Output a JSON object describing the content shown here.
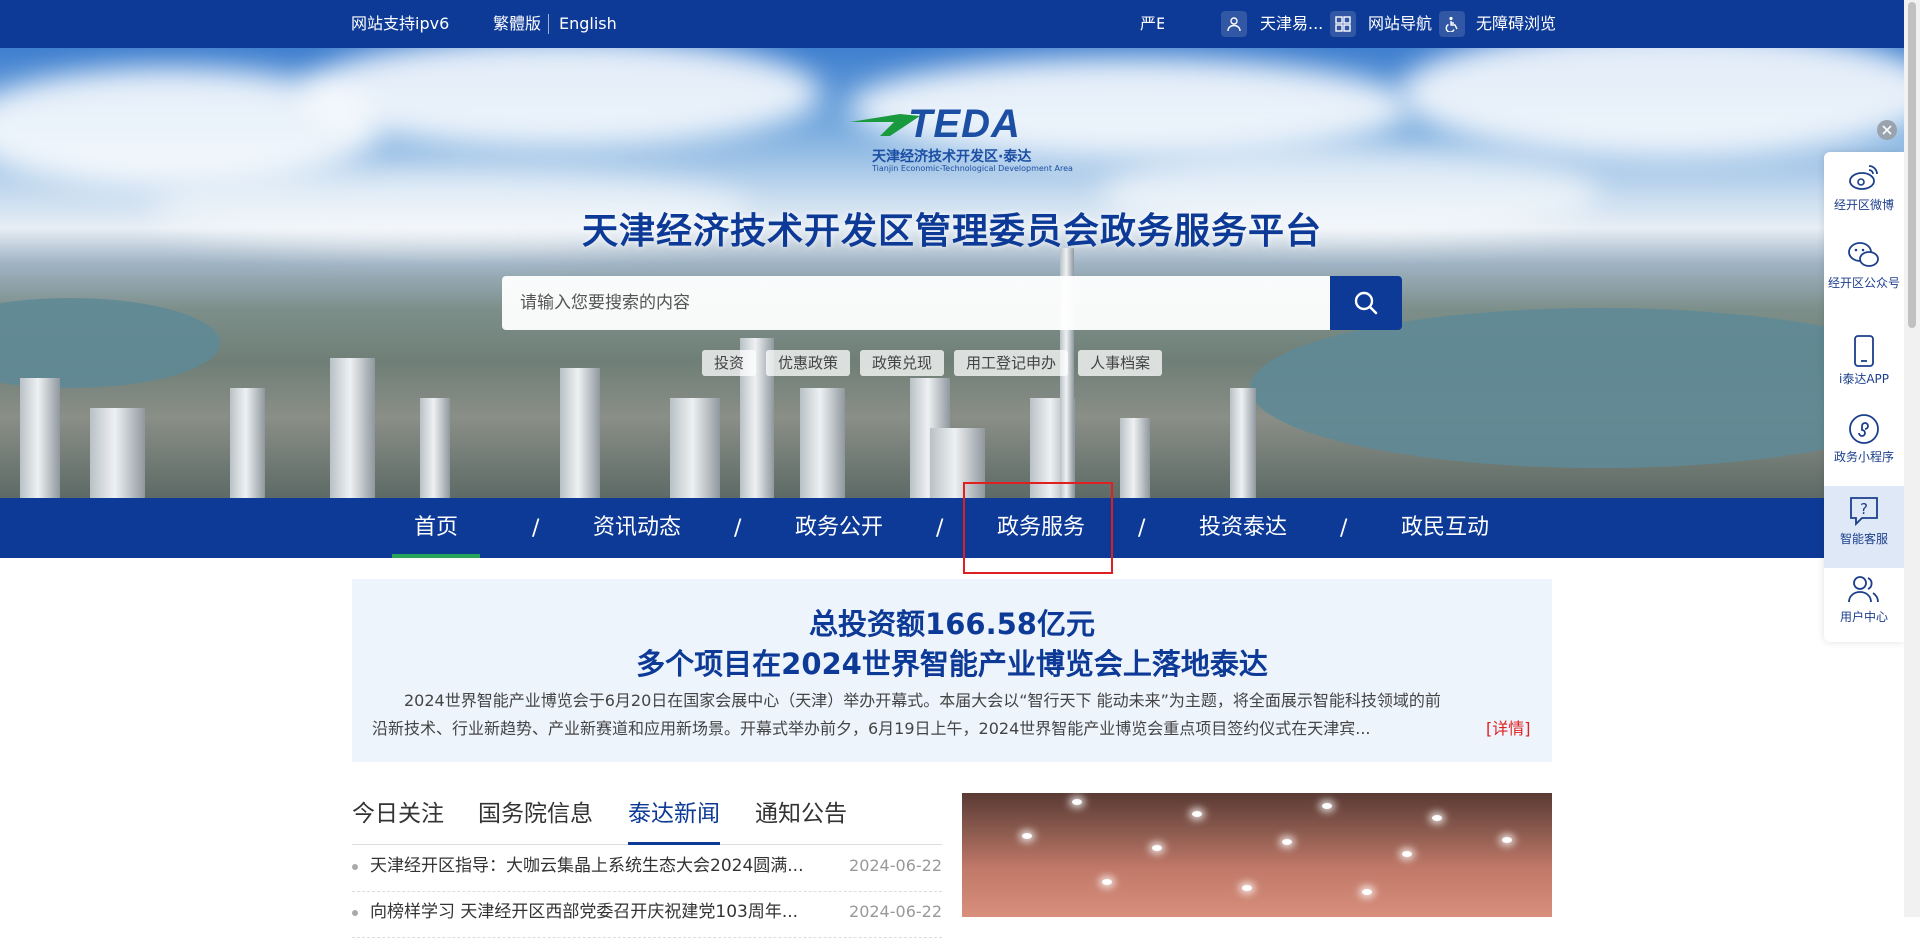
{
  "topbar": {
    "ipv6": "网站支持ipv6",
    "traditional": "繁體版",
    "english": "English",
    "partial": "严E",
    "user": "天津易...",
    "site_nav": "网站导航",
    "accessible": "无障碍浏览"
  },
  "banner": {
    "logo_word": "TEDA",
    "logo_cn": "天津经济技术开发区·泰达",
    "logo_en": "Tianjin Economic-Technological Development Area",
    "title": "天津经济技术开发区管理委员会政务服务平台",
    "search_placeholder": "请输入您要搜索的内容",
    "hot_tags": [
      "投资",
      "优惠政策",
      "政策兑现",
      "用工登记申办",
      "人事档案"
    ]
  },
  "nav": {
    "items": [
      "首页",
      "资讯动态",
      "政务公开",
      "政务服务",
      "投资泰达",
      "政民互动"
    ],
    "separator": "/"
  },
  "headline": {
    "title1": "总投资额166.58亿元",
    "title2": "多个项目在2024世界智能产业博览会上落地泰达",
    "line1": "　　2024世界智能产业博览会于6月20日在国家会展中心（天津）举办开幕式。本届大会以“智行天下 能动未来”为主题，将全面展示智能科技领域的前",
    "line2": "沿新技术、行业新趋势、产业新赛道和应用新场景。开幕式举办前夕，6月19日上午，2024世界智能产业博览会重点项目签约仪式在天津宾...",
    "more": "[详情]"
  },
  "tabs": [
    "今日关注",
    "国务院信息",
    "泰达新闻",
    "通知公告"
  ],
  "news": [
    {
      "title": "天津经开区指导：大咖云集晶上系统生态大会2024圆满...",
      "date": "2024-06-22"
    },
    {
      "title": "向榜样学习 天津经开区西部党委召开庆祝建党103周年...",
      "date": "2024-06-22"
    }
  ],
  "sidebar": {
    "items": [
      "经开区微博",
      "经开区公众号",
      "i泰达APP",
      "政务小程序",
      "智能客服",
      "用户中心"
    ]
  },
  "colors": {
    "brand_blue": "#0d3a96",
    "accent_green": "#27a35a",
    "alert_red": "#e02020"
  }
}
